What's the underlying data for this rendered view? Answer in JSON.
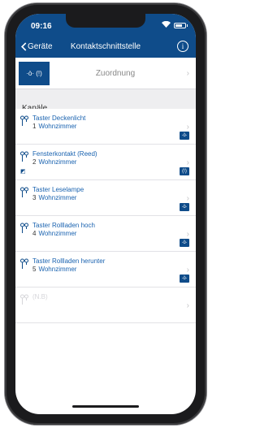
{
  "status": {
    "time": "09:16"
  },
  "nav": {
    "back_label": "Geräte",
    "title": "Kontaktschnittstelle",
    "info_glyph": "i"
  },
  "assign": {
    "icons": "·ò· (!)",
    "label": "Zuordnung"
  },
  "section": {
    "label": "Kanäle"
  },
  "channels": [
    {
      "title": "Taster Deckenlicht",
      "number": "1",
      "room": "Wohnzimmer",
      "badge": "·ò·",
      "left_badge": ""
    },
    {
      "title": "Fensterkontakt (Reed)",
      "number": "2",
      "room": "Wohnzimmer",
      "badge": "(!)",
      "left_badge": "◩"
    },
    {
      "title": "Taster Leselampe",
      "number": "3",
      "room": "Wohnzimmer",
      "badge": "·ò·",
      "left_badge": ""
    },
    {
      "title": "Taster Rollladen hoch",
      "number": "4",
      "room": "Wohnzimmer",
      "badge": "·ò·",
      "left_badge": ""
    },
    {
      "title": "Taster Rollladen herunter",
      "number": "5",
      "room": "Wohnzimmer",
      "badge": "·ò·",
      "left_badge": ""
    },
    {
      "title": "(N.B)",
      "number": "",
      "room": "",
      "badge": "",
      "left_badge": ""
    }
  ],
  "chevron": "›",
  "colors": {
    "primary": "#0f4c8a",
    "link": "#1a63b0",
    "section_bg": "#eeeef0"
  }
}
